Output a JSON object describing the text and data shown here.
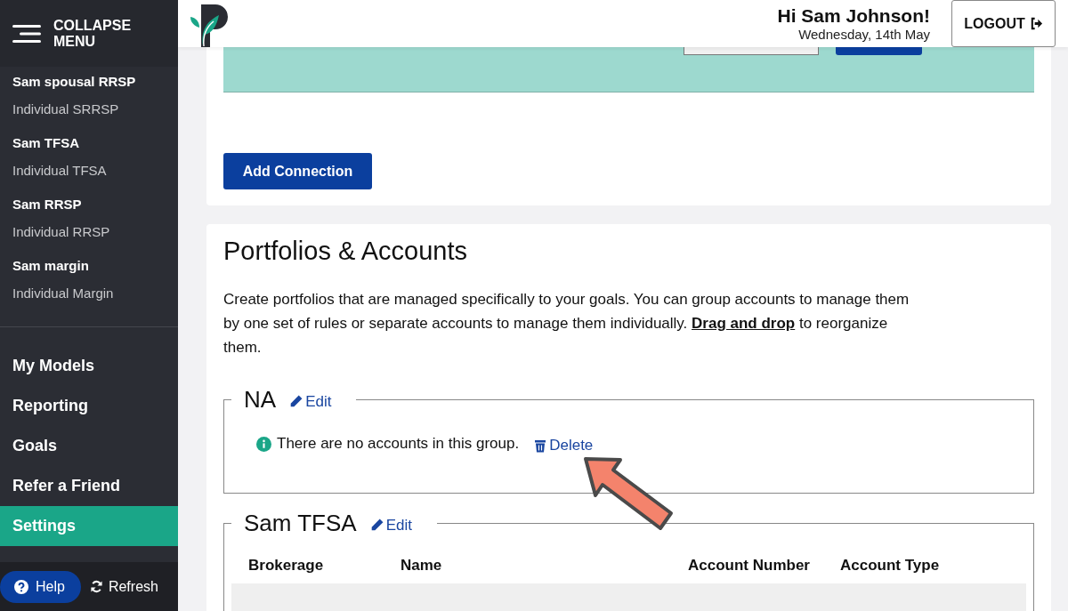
{
  "sidebar": {
    "collapse_label": "COLLAPSE MENU",
    "accounts": [
      {
        "name": "Sam spousal RRSP",
        "type": "Individual SRRSP"
      },
      {
        "name": "Sam TFSA",
        "type": "Individual TFSA"
      },
      {
        "name": "Sam RRSP",
        "type": "Individual RRSP"
      },
      {
        "name": "Sam margin",
        "type": "Individual Margin"
      }
    ],
    "nav": [
      {
        "label": "My Models",
        "selected": false
      },
      {
        "label": "Reporting",
        "selected": false
      },
      {
        "label": "Goals",
        "selected": false
      },
      {
        "label": "Refer a Friend",
        "selected": false
      },
      {
        "label": "Settings",
        "selected": true
      }
    ],
    "help": "Help",
    "refresh": "Refresh"
  },
  "header": {
    "greeting": "Hi Sam Johnson!",
    "date": "Wednesday, 14th May",
    "logout": "LOGOUT"
  },
  "connections": {
    "add_button": "Add Connection"
  },
  "portfolios": {
    "title": "Portfolios & Accounts",
    "description_before": "Create portfolios that are managed specifically to your goals. You can group accounts to manage them by one set of rules or separate accounts to manage them individually.",
    "description_link": "Drag and drop",
    "description_after": "to reorganize them.",
    "groups": [
      {
        "kind": "empty",
        "name": "NA",
        "edit": "Edit",
        "message": "There are no accounts in this group.",
        "delete": "Delete"
      },
      {
        "kind": "table",
        "name": "Sam TFSA",
        "edit": "Edit",
        "columns": [
          "Brokerage",
          "Name",
          "Account Number",
          "Account Type"
        ]
      }
    ]
  }
}
